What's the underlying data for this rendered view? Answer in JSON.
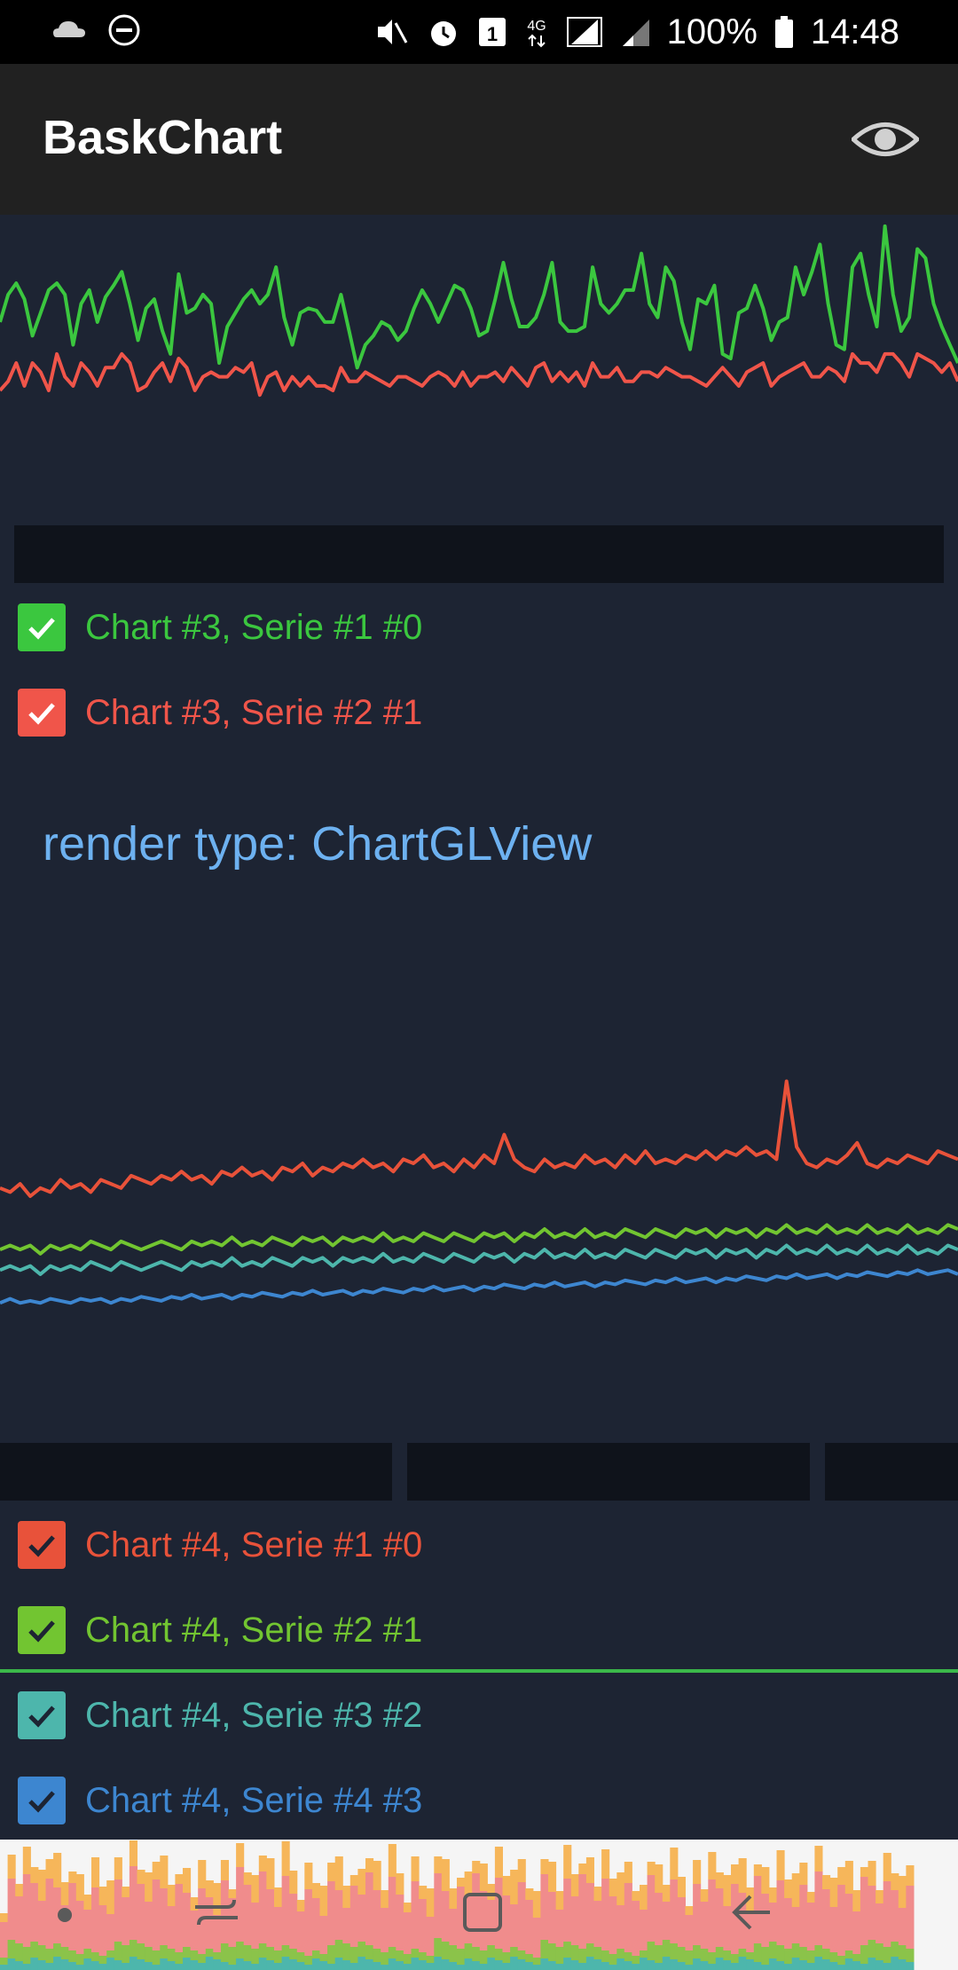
{
  "status_bar": {
    "battery_text": "100%",
    "time": "14:48",
    "icons": [
      "cloud-icon",
      "do-not-disturb-icon",
      "mute-icon",
      "alarm-icon",
      "sim-1-icon",
      "4g-icon",
      "signal-icon",
      "signal-secondary-icon",
      "battery-icon"
    ]
  },
  "app_bar": {
    "title": "BaskChart",
    "action_icon": "eye-icon"
  },
  "chart3": {
    "series": [
      {
        "color": "#3bc73f",
        "values": [
          58,
          70,
          75,
          68,
          52,
          62,
          72,
          75,
          70,
          48,
          66,
          72,
          58,
          69,
          74,
          80,
          66,
          50,
          64,
          68,
          54,
          44,
          79,
          62,
          64,
          70,
          66,
          40,
          56,
          62,
          68,
          72,
          66,
          70,
          82,
          60,
          48,
          62,
          64,
          63,
          58,
          58,
          70,
          54,
          38,
          48,
          52,
          58,
          56,
          50,
          54,
          64,
          72,
          66,
          58,
          66,
          74,
          72,
          64,
          52,
          54,
          68,
          84,
          68,
          56,
          56,
          60,
          70,
          84,
          58,
          54,
          54,
          56,
          82,
          66,
          62,
          66,
          72,
          72,
          88,
          66,
          60,
          82,
          76,
          58,
          46,
          68,
          66,
          74,
          44,
          42,
          62,
          64,
          74,
          64,
          50,
          58,
          60,
          82,
          70,
          80,
          92,
          66,
          48,
          46,
          82,
          88,
          70,
          56,
          100,
          70,
          54,
          60,
          90,
          86,
          66,
          56,
          48,
          40
        ]
      },
      {
        "color": "#f0554a",
        "values": [
          28,
          32,
          40,
          30,
          40,
          36,
          28,
          44,
          34,
          30,
          40,
          36,
          30,
          38,
          38,
          44,
          40,
          28,
          30,
          36,
          40,
          32,
          42,
          38,
          28,
          34,
          36,
          34,
          34,
          38,
          36,
          40,
          26,
          34,
          36,
          28,
          34,
          30,
          34,
          30,
          30,
          28,
          38,
          32,
          32,
          36,
          34,
          32,
          30,
          34,
          34,
          32,
          30,
          34,
          36,
          34,
          30,
          36,
          30,
          34,
          34,
          36,
          32,
          38,
          34,
          30,
          38,
          40,
          32,
          36,
          32,
          36,
          30,
          40,
          34,
          34,
          38,
          32,
          32,
          36,
          36,
          34,
          38,
          36,
          34,
          34,
          32,
          30,
          34,
          38,
          34,
          30,
          36,
          38,
          40,
          30,
          34,
          36,
          38,
          40,
          34,
          34,
          38,
          36,
          32,
          44,
          40,
          40,
          36,
          44,
          44,
          40,
          34,
          44,
          42,
          40,
          36,
          40,
          32
        ]
      }
    ]
  },
  "chart3_legend": [
    {
      "label": "Chart #3, Serie #1 #0",
      "color": "#3bc73f",
      "checked": true
    },
    {
      "label": "Chart #3, Serie #2 #1",
      "color": "#f0554a",
      "checked": true
    }
  ],
  "render_type": "render type: ChartGLView",
  "chart4": {
    "series": [
      {
        "color": "#e8523a",
        "values": [
          40,
          38,
          42,
          36,
          40,
          38,
          44,
          40,
          42,
          38,
          44,
          42,
          40,
          46,
          44,
          42,
          46,
          44,
          48,
          44,
          46,
          42,
          48,
          46,
          50,
          46,
          48,
          44,
          50,
          48,
          52,
          46,
          50,
          48,
          52,
          50,
          54,
          50,
          52,
          48,
          54,
          52,
          56,
          50,
          52,
          48,
          54,
          50,
          56,
          52,
          66,
          54,
          50,
          48,
          54,
          50,
          52,
          50,
          56,
          52,
          54,
          50,
          56,
          52,
          58,
          52,
          54,
          52,
          56,
          54,
          58,
          54,
          58,
          56,
          60,
          56,
          58,
          54,
          92,
          60,
          52,
          50,
          54,
          52,
          56,
          62,
          52,
          50,
          54,
          52,
          56,
          54,
          52,
          58,
          56,
          54
        ]
      },
      {
        "color": "#72c531",
        "values": [
          10,
          12,
          10,
          12,
          8,
          12,
          10,
          12,
          10,
          14,
          12,
          10,
          14,
          12,
          10,
          12,
          14,
          12,
          10,
          14,
          12,
          14,
          12,
          16,
          12,
          14,
          12,
          16,
          14,
          12,
          16,
          14,
          16,
          12,
          16,
          14,
          16,
          14,
          18,
          14,
          16,
          14,
          18,
          16,
          14,
          18,
          16,
          14,
          18,
          16,
          18,
          14,
          18,
          16,
          20,
          16,
          18,
          16,
          20,
          16,
          18,
          16,
          20,
          18,
          16,
          20,
          18,
          16,
          20,
          18,
          20,
          16,
          20,
          18,
          20,
          16,
          20,
          18,
          22,
          18,
          20,
          18,
          22,
          18,
          20,
          18,
          22,
          18,
          20,
          18,
          22,
          18,
          20,
          18,
          22,
          20
        ]
      },
      {
        "color": "#4db6ac",
        "values": [
          0,
          2,
          0,
          2,
          -2,
          2,
          0,
          2,
          0,
          4,
          2,
          0,
          4,
          2,
          0,
          2,
          4,
          2,
          0,
          4,
          2,
          4,
          2,
          6,
          2,
          4,
          2,
          6,
          4,
          2,
          6,
          4,
          6,
          2,
          6,
          4,
          6,
          4,
          8,
          4,
          6,
          4,
          8,
          6,
          4,
          8,
          6,
          4,
          8,
          6,
          8,
          4,
          8,
          6,
          10,
          6,
          8,
          6,
          10,
          6,
          8,
          6,
          10,
          8,
          6,
          10,
          8,
          6,
          10,
          8,
          10,
          6,
          10,
          8,
          10,
          6,
          10,
          8,
          12,
          8,
          10,
          8,
          12,
          8,
          10,
          8,
          12,
          8,
          10,
          8,
          12,
          8,
          10,
          8,
          12,
          10
        ]
      },
      {
        "color": "#3d86d0",
        "values": [
          -16,
          -14,
          -16,
          -15,
          -16,
          -14,
          -15,
          -16,
          -14,
          -15,
          -14,
          -16,
          -14,
          -15,
          -13,
          -14,
          -15,
          -13,
          -14,
          -12,
          -14,
          -13,
          -12,
          -14,
          -12,
          -13,
          -11,
          -12,
          -13,
          -11,
          -12,
          -10,
          -12,
          -11,
          -10,
          -12,
          -10,
          -11,
          -9,
          -10,
          -11,
          -9,
          -10,
          -8,
          -10,
          -9,
          -8,
          -10,
          -8,
          -9,
          -7,
          -8,
          -9,
          -7,
          -8,
          -6,
          -8,
          -7,
          -6,
          -8,
          -6,
          -7,
          -5,
          -6,
          -7,
          -5,
          -6,
          -4,
          -6,
          -5,
          -4,
          -6,
          -4,
          -5,
          -3,
          -4,
          -5,
          -3,
          -4,
          -2,
          -4,
          -3,
          -2,
          -4,
          -2,
          -3,
          -1,
          -2,
          -3,
          -1,
          -2,
          0,
          -2,
          -1,
          0,
          -2
        ]
      }
    ]
  },
  "chart4_legend": [
    {
      "label": "Chart #4, Serie #1 #0",
      "color": "#e8523a",
      "checked": true
    },
    {
      "label": "Chart #4, Serie #2 #1",
      "color": "#72c531",
      "checked": true
    },
    {
      "label": "Chart #4, Serie #3 #2",
      "color": "#4db6ac",
      "checked": true
    },
    {
      "label": "Chart #4, Serie #4 #3",
      "color": "#3d86d0",
      "checked": true
    }
  ],
  "nav_bar": {
    "icons": [
      "dot-icon",
      "recent-apps-icon",
      "home-icon",
      "back-icon"
    ]
  }
}
